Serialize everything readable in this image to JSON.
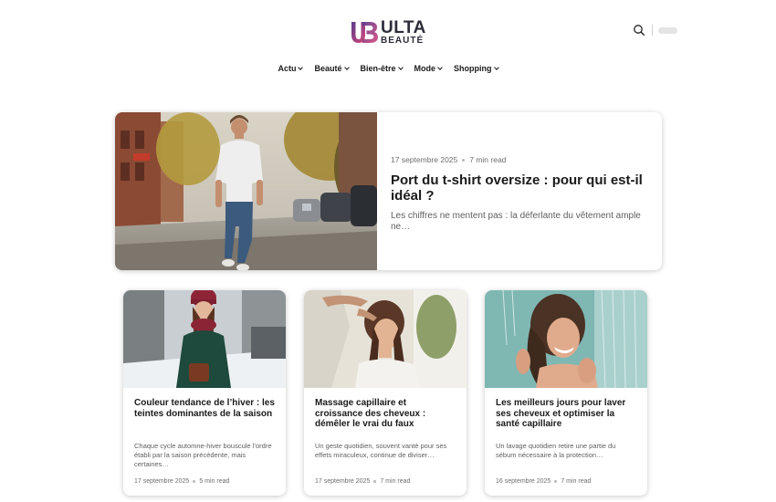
{
  "header": {
    "logo": {
      "mark": "UB",
      "line1": "ULTA",
      "line2": "BEAUTÉ"
    },
    "icons": {
      "search": "search-icon"
    }
  },
  "nav": [
    {
      "label": "Actu"
    },
    {
      "label": "Beauté"
    },
    {
      "label": "Bien-être"
    },
    {
      "label": "Mode"
    },
    {
      "label": "Shopping"
    }
  ],
  "featured": {
    "date": "17 septembre 2025",
    "read": "7 min read",
    "title": "Port du t-shirt oversize : pour qui est-il idéal ?",
    "excerpt": "Les chiffres ne mentent pas : la déferlante du vêtement ample ne…"
  },
  "cards": [
    {
      "title": "Couleur tendance de l’hiver : les teintes dominantes de la saison",
      "excerpt": "Chaque cycle automne-hiver bouscule l’ordre établi par la saison précédente, mais certaines…",
      "date": "17 septembre 2025",
      "read": "5 min read"
    },
    {
      "title": "Massage capillaire et croissance des cheveux : démêler le vrai du faux",
      "excerpt": "Un geste quotidien, souvent vanté pour ses effets miraculeux, continue de diviser…",
      "date": "17 septembre 2025",
      "read": "7 min read"
    },
    {
      "title": "Les meilleurs jours pour laver ses cheveux et optimiser la santé capillaire",
      "excerpt": "Un lavage quotidien retire une partie du sébum nécessaire à la protection…",
      "date": "16 septembre 2025",
      "read": "7 min read"
    }
  ],
  "colors": {
    "logo_gradient_start": "#5b3a8c",
    "logo_gradient_end": "#d9477b",
    "text": "#1a1a1a",
    "meta": "#6d6d6d"
  }
}
